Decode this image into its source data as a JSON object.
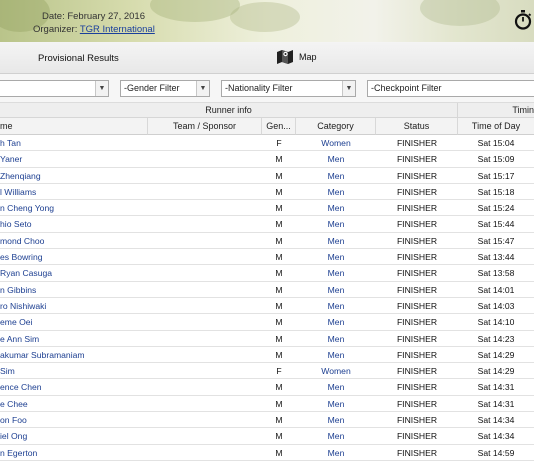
{
  "banner": {
    "date_text": "Date: February 27, 2016",
    "organizer_label": "Organizer: ",
    "organizer_link": "TGR International",
    "stopwatch_icon": "stopwatch-icon"
  },
  "toolbar": {
    "results_title": "Provisional Results",
    "map_label": "Map",
    "map_icon": "map-icon"
  },
  "filters": {
    "search_value": "",
    "gender": "-Gender Filter",
    "nationality": "-Nationality Filter",
    "checkpoint": "-Checkpoint Filter"
  },
  "table": {
    "group_headers": {
      "runner_info": "Runner info",
      "timing": "Timin"
    },
    "columns": {
      "name": "me",
      "team": "Team / Sponsor",
      "gender": "Gen...",
      "category": "Category",
      "status": "Status",
      "time": "Time of Day"
    },
    "rows": [
      {
        "name": "h Tan",
        "team": "",
        "gender": "F",
        "category": "Women",
        "status": "FINISHER",
        "time": "Sat 15:04"
      },
      {
        "name": "Yaner",
        "team": "",
        "gender": "M",
        "category": "Men",
        "status": "FINISHER",
        "time": "Sat 15:09"
      },
      {
        "name": "Zhenqiang",
        "team": "",
        "gender": "M",
        "category": "Men",
        "status": "FINISHER",
        "time": "Sat 15:17"
      },
      {
        "name": "l Williams",
        "team": "",
        "gender": "M",
        "category": "Men",
        "status": "FINISHER",
        "time": "Sat 15:18"
      },
      {
        "name": "n Cheng Yong",
        "team": "",
        "gender": "M",
        "category": "Men",
        "status": "FINISHER",
        "time": "Sat 15:24"
      },
      {
        "name": "hio Seto",
        "team": "",
        "gender": "M",
        "category": "Men",
        "status": "FINISHER",
        "time": "Sat 15:44"
      },
      {
        "name": "mond Choo",
        "team": "",
        "gender": "M",
        "category": "Men",
        "status": "FINISHER",
        "time": "Sat 15:47"
      },
      {
        "name": "es Bowring",
        "team": "",
        "gender": "M",
        "category": "Men",
        "status": "FINISHER",
        "time": "Sat 13:44"
      },
      {
        "name": "Ryan Casuga",
        "team": "",
        "gender": "M",
        "category": "Men",
        "status": "FINISHER",
        "time": "Sat 13:58"
      },
      {
        "name": "n Gibbins",
        "team": "",
        "gender": "M",
        "category": "Men",
        "status": "FINISHER",
        "time": "Sat 14:01"
      },
      {
        "name": "ro Nishiwaki",
        "team": "",
        "gender": "M",
        "category": "Men",
        "status": "FINISHER",
        "time": "Sat 14:03"
      },
      {
        "name": "eme Oei",
        "team": "",
        "gender": "M",
        "category": "Men",
        "status": "FINISHER",
        "time": "Sat 14:10"
      },
      {
        "name": "e Ann Sim",
        "team": "",
        "gender": "M",
        "category": "Men",
        "status": "FINISHER",
        "time": "Sat 14:23"
      },
      {
        "name": "akumar Subramaniam",
        "team": "",
        "gender": "M",
        "category": "Men",
        "status": "FINISHER",
        "time": "Sat 14:29"
      },
      {
        "name": "Sim",
        "team": "",
        "gender": "F",
        "category": "Women",
        "status": "FINISHER",
        "time": "Sat 14:29"
      },
      {
        "name": "ence Chen",
        "team": "",
        "gender": "M",
        "category": "Men",
        "status": "FINISHER",
        "time": "Sat 14:31"
      },
      {
        "name": "e Chee",
        "team": "",
        "gender": "M",
        "category": "Men",
        "status": "FINISHER",
        "time": "Sat 14:31"
      },
      {
        "name": "on Foo",
        "team": "",
        "gender": "M",
        "category": "Men",
        "status": "FINISHER",
        "time": "Sat 14:34"
      },
      {
        "name": "iel Ong",
        "team": "",
        "gender": "M",
        "category": "Men",
        "status": "FINISHER",
        "time": "Sat 14:34"
      },
      {
        "name": "n Egerton",
        "team": "",
        "gender": "M",
        "category": "Men",
        "status": "FINISHER",
        "time": "Sat 14:59"
      }
    ]
  },
  "colors": {
    "link_blue": "#1d3f91",
    "header_grey": "#f3f3f3"
  }
}
